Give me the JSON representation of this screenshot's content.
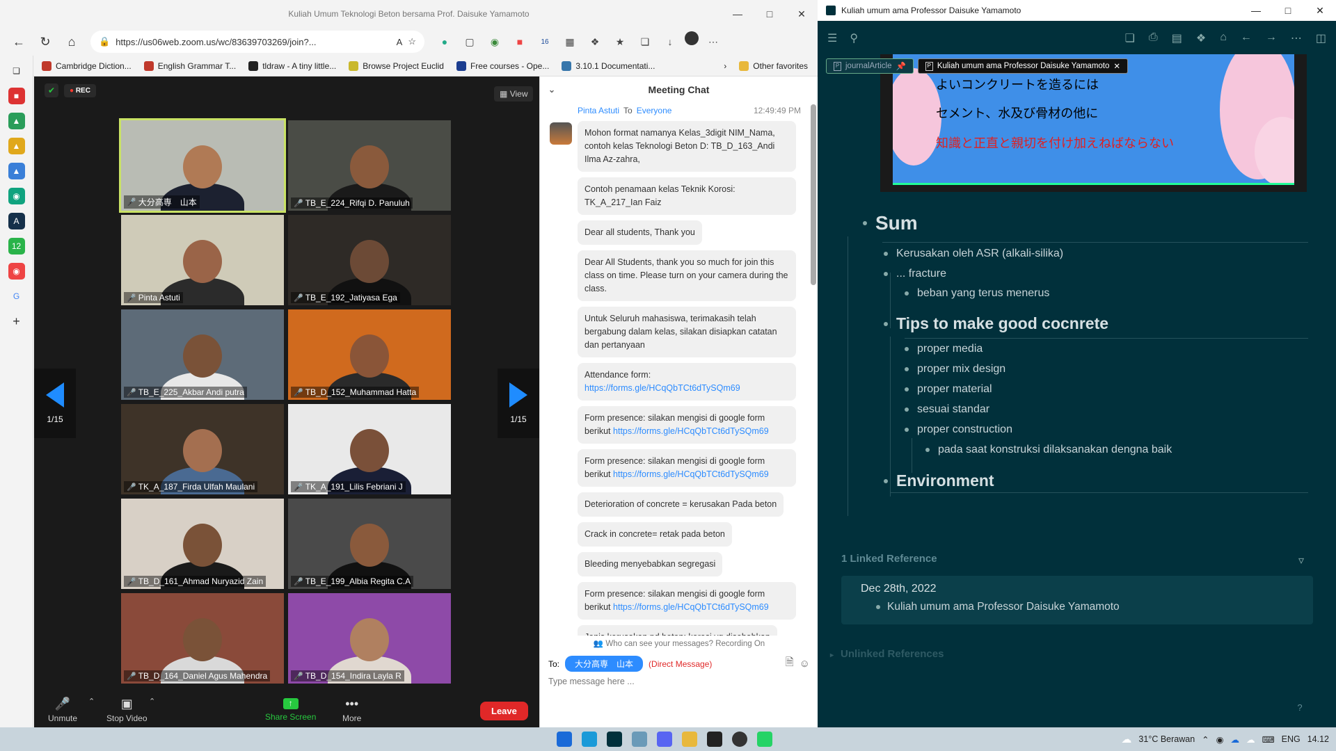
{
  "browser": {
    "title": "Kuliah Umum Teknologi Beton bersama Prof. Daisuke Yamamoto",
    "url": "https://us06web.zoom.us/wc/83639703269/join?...",
    "ext_badge": "16",
    "favorites": [
      {
        "label": "Cambridge Diction...",
        "color": "#c0392b"
      },
      {
        "label": "English Grammar T...",
        "color": "#c0392b"
      },
      {
        "label": "tldraw - A tiny little...",
        "color": "#222"
      },
      {
        "label": "Browse Project Euclid",
        "color": "#c9b82c"
      },
      {
        "label": "Free courses - Ope...",
        "color": "#1b3d8f"
      },
      {
        "label": "3.10.1 Documentati...",
        "color": "#3776ab"
      }
    ],
    "other_favorites": "Other favorites"
  },
  "zoom": {
    "rec_label": "REC",
    "view_label": "View",
    "page_indicator": "1/15",
    "participants": [
      {
        "name": "大分高専　山本",
        "muted": false,
        "active": true,
        "bg": "#b9bcb4",
        "skin": "#b07a55",
        "shirt": "#1c2130"
      },
      {
        "name": "TB_E_224_Rifqi D. Panuluh",
        "muted": true,
        "active": false,
        "bg": "#4a4c46",
        "skin": "#8a5a3c",
        "shirt": "#1a1a1a"
      },
      {
        "name": "Pinta Astuti",
        "muted": false,
        "active": false,
        "bg": "#cfcbb8",
        "skin": "#9a6448",
        "shirt": "#2b2b2b"
      },
      {
        "name": "TB_E_192_Jatiyasa Ega",
        "muted": true,
        "active": false,
        "bg": "#2e2a26",
        "skin": "#6c4a36",
        "shirt": "#111"
      },
      {
        "name": "TB_E_225_Akbar Andi putra",
        "muted": true,
        "active": false,
        "bg": "#5d6b78",
        "skin": "#7a5238",
        "shirt": "#e8e8e8"
      },
      {
        "name": "TB_D_152_Muhammad Hatta",
        "muted": true,
        "active": false,
        "bg": "#d06a1e",
        "skin": "#8a5538",
        "shirt": "#2a2a2a"
      },
      {
        "name": "TK_A_187_Firda Ulfah Maulani",
        "muted": true,
        "active": false,
        "bg": "#3e3328",
        "skin": "#a46f50",
        "shirt": "#4a6a92"
      },
      {
        "name": "TK_A_191_Lilis Febriani J",
        "muted": true,
        "active": false,
        "bg": "#e9e9e9",
        "skin": "#7a5039",
        "shirt": "#1a1f36"
      },
      {
        "name": "TB_D_161_Ahmad Nuryazid Zain",
        "muted": true,
        "active": false,
        "bg": "#d8d0c6",
        "skin": "#7a5238",
        "shirt": "#1a1a1a"
      },
      {
        "name": "TB_E_199_Albia Regita C.A",
        "muted": true,
        "active": false,
        "bg": "#4a4a4a",
        "skin": "#8a5a3c",
        "shirt": "#111"
      },
      {
        "name": "TB_D_164_Daniel Agus Mahendra",
        "muted": true,
        "active": false,
        "bg": "#8a4a3a",
        "skin": "#7a5238",
        "shirt": "#d9d9d9"
      },
      {
        "name": "TB_D_154_Indira Layla R",
        "muted": true,
        "active": false,
        "bg": "#8e4aa8",
        "skin": "#b08060",
        "shirt": "#e0d8d0"
      }
    ],
    "toolbar": {
      "unmute": "Unmute",
      "stop_video": "Stop Video",
      "share_screen": "Share Screen",
      "more": "More",
      "leave": "Leave"
    }
  },
  "chat": {
    "title": "Meeting Chat",
    "sender": "Pinta Astuti",
    "to_word": "To",
    "recipient": "Everyone",
    "time": "12:49:49 PM",
    "messages": [
      {
        "text": "Mohon format namanya Kelas_3digit NIM_Nama, contoh kelas Teknologi Beton D: TB_D_163_Andi Ilma Az-zahra,",
        "link": ""
      },
      {
        "text": "Contoh penamaan kelas Teknik Korosi: TK_A_217_Ian Faiz",
        "link": ""
      },
      {
        "text": "Dear all students, Thank you",
        "link": ""
      },
      {
        "text": "Dear All Students, thank you so much for join this class on time. Please turn on your camera during the class.",
        "link": ""
      },
      {
        "text": "Untuk Seluruh mahasiswa, terimakasih telah bergabung dalam kelas, silakan disiapkan catatan dan pertanyaan",
        "link": ""
      },
      {
        "text": "Attendance form:",
        "link": "https://forms.gle/HCqQbTCt6dTySQm69"
      },
      {
        "text": "Form presence: silakan mengisi di google form berikut",
        "link": "https://forms.gle/HCqQbTCt6dTySQm69"
      },
      {
        "text": "Form presence: silakan mengisi di google form berikut",
        "link": "https://forms.gle/HCqQbTCt6dTySQm69"
      },
      {
        "text": "Deterioration of concrete = kerusakan Pada beton",
        "link": ""
      },
      {
        "text": "Crack in concrete= retak pada beton",
        "link": ""
      },
      {
        "text": "Bleeding menyebabkan segregasi",
        "link": ""
      },
      {
        "text": "Form presence: silakan mengisi di google form berikut",
        "link": "https://forms.gle/HCqQbTCt6dTySQm69"
      },
      {
        "text": "Jenis kerusakan pd beton: korosi yg disebabkan",
        "link": ""
      }
    ],
    "privacy": "Who can see your messages? Recording On",
    "to_label": "To:",
    "to_chip": "大分高専　山本",
    "dm": "(Direct Message)",
    "placeholder": "Type message here ..."
  },
  "notes": {
    "window_title": "Kuliah umum ama Professor Daisuke Yamamoto",
    "tabs": [
      {
        "label": "journalArticle",
        "pinned": true
      },
      {
        "label": "Kuliah umum ama Professor Daisuke Yamamoto",
        "pinned": false
      }
    ],
    "slide_lines": [
      {
        "text": "よいコンクリートを造るには",
        "red": false
      },
      {
        "text": "セメント、水及び骨材の他に",
        "red": false
      },
      {
        "text": "知識と正直と親切を付け加えねばならない",
        "red": true
      }
    ],
    "outline": {
      "sum": "Sum",
      "b1": "Kerusakan oleh ASR (alkali-silika)",
      "b2": "... fracture",
      "b2a": "beban yang terus menerus",
      "tips": "Tips to make good cocnrete",
      "t1": "proper media",
      "t2": "proper mix design",
      "t3": "proper material",
      "t4": "sesuai standar",
      "t5": "proper construction",
      "t5a": "pada saat konstruksi dilaksanakan dengna baik",
      "env": "Environment"
    },
    "linked_title": "1 Linked Reference",
    "ref_date": "Dec 28th, 2022",
    "ref_item": "Kuliah umum ama Professor Daisuke Yamamoto",
    "unlinked_title": "Unlinked References",
    "help": "?"
  },
  "taskbar": {
    "weather": "31°C  Berawan",
    "lang": "ENG",
    "time": "14.12"
  }
}
